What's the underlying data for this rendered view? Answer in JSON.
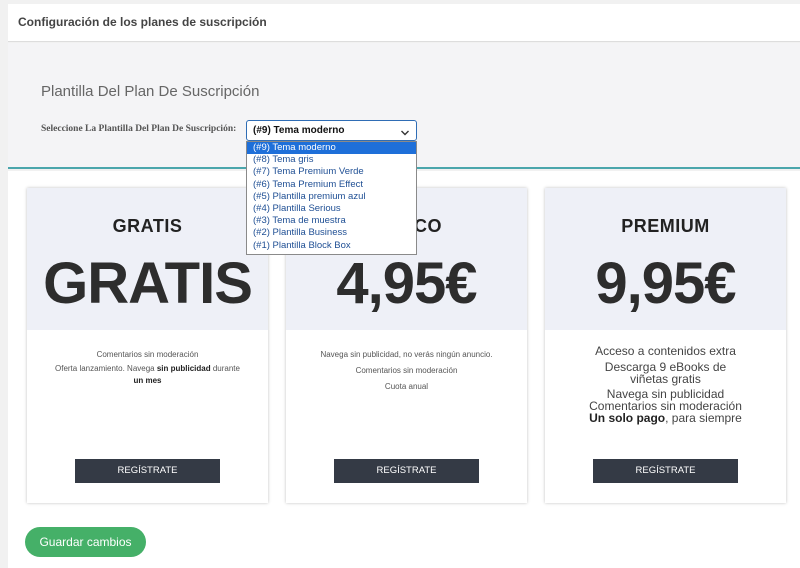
{
  "header": {
    "title": "Configuración de los planes de suscripción"
  },
  "template": {
    "title": "Plantilla Del Plan De Suscripción",
    "label": "Seleccione La Plantilla Del Plan De Suscripción:",
    "selected": "(#9) Tema moderno",
    "options": [
      "(#9) Tema moderno",
      "(#8) Tema gris",
      "(#7) Tema Premium Verde",
      "(#6) Tema Premium Effect",
      "(#5) Plantilla premium azul",
      "(#4) Plantilla Serious",
      "(#3) Tema de muestra",
      "(#2) Plantilla Business",
      "(#1) Plantilla Block Box"
    ]
  },
  "plans": [
    {
      "name": "GRATIS",
      "price": "GRATIS",
      "feature_1": "Comentarios sin moderación",
      "feature_2_pre": "Oferta lanzamiento. Navega ",
      "feature_2_bold": "sin publicidad",
      "feature_2_post": " durante",
      "feature_3_bold": "un mes",
      "button": "REGÍSTRATE"
    },
    {
      "name": "CO",
      "price": "4,95€",
      "feature_1": "Navega sin publicidad, no verás ningún anuncio.",
      "feature_2": "Comentarios sin moderación",
      "feature_3": "Cuota anual",
      "button": "REGÍSTRATE"
    },
    {
      "name": "PREMIUM",
      "price": "9,95€",
      "feature_1": "Acceso a contenidos extra",
      "feature_2": "Descarga 9 eBooks de viñetas gratis",
      "feature_3": "Navega sin publicidad",
      "feature_4": "Comentarios sin moderación",
      "feature_5_bold": "Un solo pago",
      "feature_5_post": ", para siempre",
      "button": "REGÍSTRATE"
    }
  ],
  "save_button": "Guardar cambios",
  "colors": {
    "accent_line": "#4aa6ac",
    "selected_option": "#1e6fd9",
    "button_dark": "#343a45",
    "save_green": "#45b068"
  },
  "icons": {
    "select_arrow": "chevron-down-icon"
  }
}
